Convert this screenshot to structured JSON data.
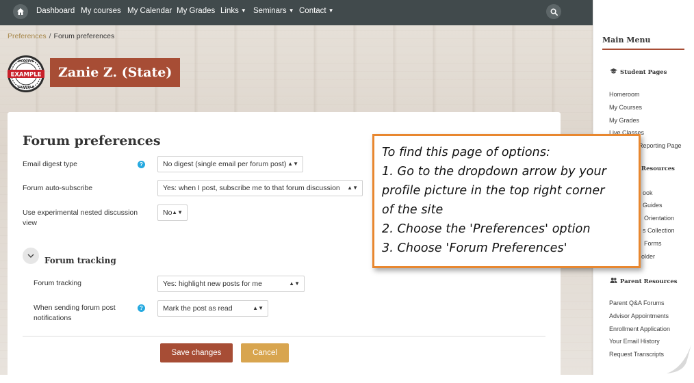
{
  "topnav": {
    "items": [
      {
        "label": "Dashboard"
      },
      {
        "label": "My courses"
      },
      {
        "label": "My Calendar"
      },
      {
        "label": "My Grades"
      },
      {
        "label": "Links"
      },
      {
        "label": "Seminars"
      },
      {
        "label": "Contact"
      }
    ],
    "home_icon": "home-icon",
    "search_icon": "search-icon"
  },
  "breadcrumb": {
    "parent": "Preferences",
    "separator": "/",
    "current": "Forum preferences"
  },
  "badge": {
    "text": "EXAMPLE",
    "ring_text": "EXAMPLE"
  },
  "user": {
    "name": "Zanie Z. (State)"
  },
  "form": {
    "title": "Forum preferences",
    "email_digest": {
      "label": "Email digest type",
      "value": "No digest (single email per forum post)"
    },
    "auto_subscribe": {
      "label": "Forum auto-subscribe",
      "value": "Yes: when I post, subscribe me to that forum discussion"
    },
    "nested_view": {
      "label": "Use experimental nested discussion view",
      "value": "No"
    },
    "tracking_section": {
      "title": "Forum tracking"
    },
    "forum_tracking": {
      "label": "Forum tracking",
      "value": "Yes: highlight new posts for me"
    },
    "notification": {
      "label": "When sending forum post notifications",
      "value": "Mark the post as read"
    },
    "save_label": "Save changes",
    "cancel_label": "Cancel",
    "help_glyph": "?"
  },
  "sidebar": {
    "title": "Main Menu",
    "student_heading": "Student Pages",
    "student_links": [
      "Homeroom",
      "My Courses",
      "My Grades",
      "Live Classes",
      "Reporting Page"
    ],
    "resources_heading": "Resources",
    "resource_links": [
      "ook",
      "Guides",
      "Orientation",
      "s Collection",
      "Forms",
      "older"
    ],
    "parent_heading": "Parent Resources",
    "parent_links": [
      "Parent Q&A Forums",
      "Advisor Appointments",
      "Enrollment Application",
      "Your Email History",
      "Request Transcripts"
    ]
  },
  "callout": {
    "lines": [
      "To find this page of options:",
      "1. Go to the dropdown arrow by your",
      "profile picture in the top right corner",
      "of the site",
      "2. Choose the 'Preferences' option",
      "3. Choose 'Forum Preferences'"
    ]
  },
  "colors": {
    "nav_bg": "#414a4c",
    "brand_red": "#a74d35",
    "cancel_gold": "#d8a54f",
    "breadcrumb_link": "#a7874a",
    "callout_border": "#e8872f",
    "help_blue": "#25a9e0"
  }
}
